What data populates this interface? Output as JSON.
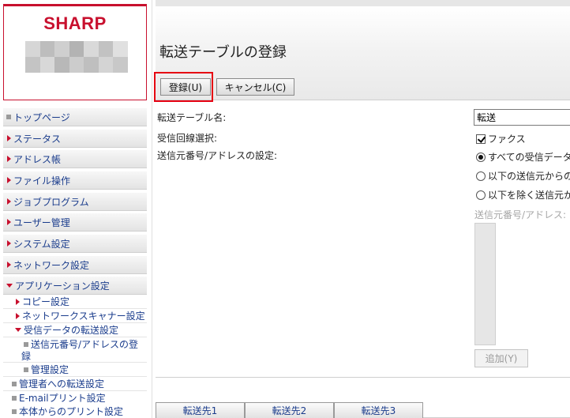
{
  "brand": {
    "logo_text": "SHARP"
  },
  "nav": {
    "items": [
      {
        "label": "トップページ",
        "kind": "bullet",
        "depth": 0
      },
      {
        "label": "ステータス",
        "kind": "collapsed",
        "depth": 0
      },
      {
        "label": "アドレス帳",
        "kind": "collapsed",
        "depth": 0
      },
      {
        "label": "ファイル操作",
        "kind": "collapsed",
        "depth": 0
      },
      {
        "label": "ジョブプログラム",
        "kind": "collapsed",
        "depth": 0
      },
      {
        "label": "ユーザー管理",
        "kind": "collapsed",
        "depth": 0
      },
      {
        "label": "システム設定",
        "kind": "collapsed",
        "depth": 0
      },
      {
        "label": "ネットワーク設定",
        "kind": "collapsed",
        "depth": 0
      },
      {
        "label": "アプリケーション設定",
        "kind": "expanded",
        "depth": 0
      }
    ],
    "sub_items": [
      {
        "label": "コピー設定",
        "kind": "collapsed"
      },
      {
        "label": "ネットワークスキャナー設定",
        "kind": "collapsed"
      },
      {
        "label": "受信データの転送設定",
        "kind": "expanded"
      },
      {
        "label_line1": "送信元番号/アドレスの登",
        "label_line2": "録",
        "kind": "bullet"
      },
      {
        "label": "管理設定",
        "kind": "bullet"
      },
      {
        "label": "管理者への転送設定",
        "kind": "bullet"
      },
      {
        "label": "E-mailプリント設定",
        "kind": "bullet"
      },
      {
        "label": "本体からのプリント設定",
        "kind": "bullet"
      }
    ]
  },
  "page": {
    "title": "転送テーブルの登録",
    "register_button": "登録(U)",
    "cancel_button": "キャンセル(C)"
  },
  "form": {
    "table_name_label": "転送テーブル名:",
    "table_name_value": "転送",
    "line_select_label": "受信回線選択:",
    "fax_option": "ファクス",
    "sender_setting_label": "送信元番号/アドレスの設定:",
    "radio_all": "すべての受信データ",
    "radio_from": "以下の送信元からの",
    "radio_except": "以下を除く送信元か",
    "sender_list_label": "送信元番号/アドレス:",
    "add_button": "追加(Y)"
  },
  "tabs": [
    "転送先1",
    "転送先2",
    "転送先3"
  ],
  "colors": {
    "brand_red": "#c8102e",
    "highlight": "#e60012",
    "nav_link": "#1a3c8c"
  }
}
